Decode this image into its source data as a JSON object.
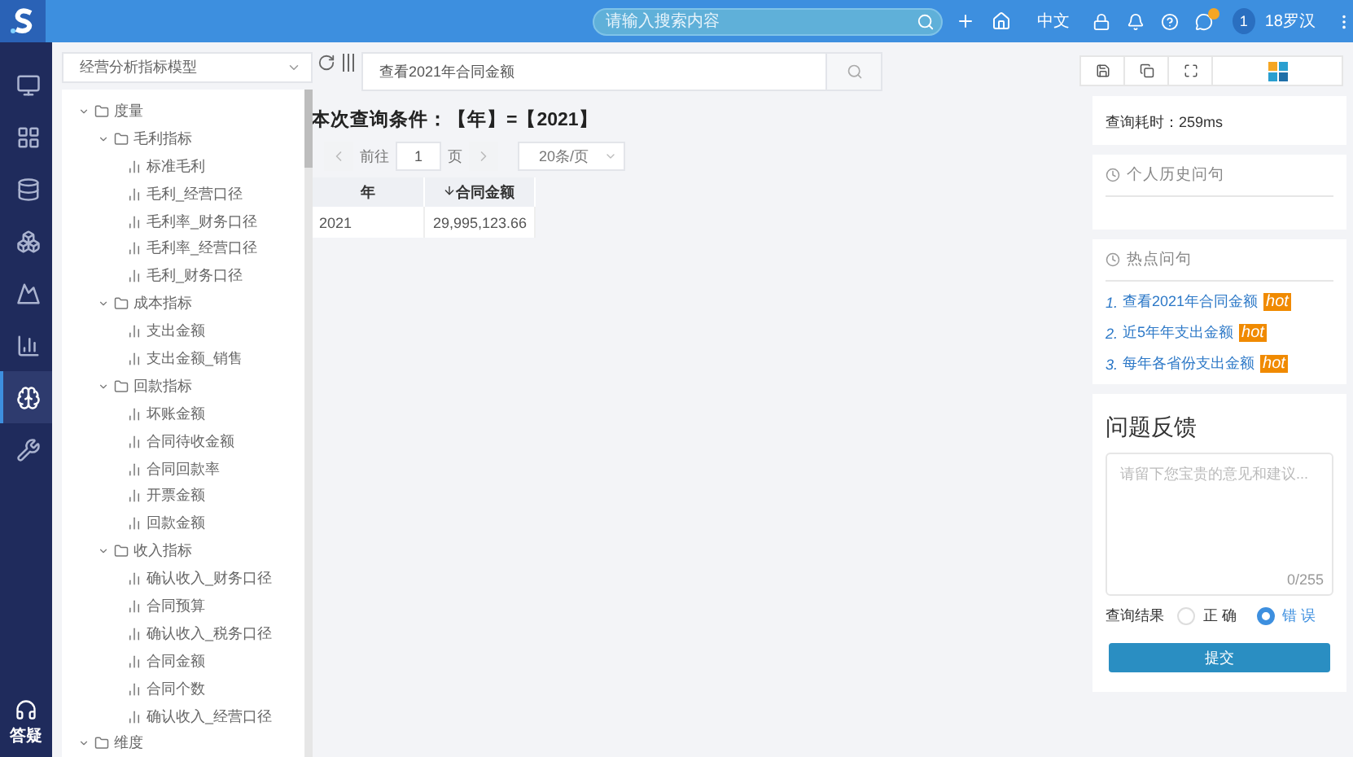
{
  "header": {
    "search": {
      "placeholder": "请输入搜索内容"
    },
    "language": "中文",
    "avatar": "1",
    "user": "18罗汉"
  },
  "nav": {
    "items": [
      {
        "selected": false
      },
      {
        "selected": false
      },
      {
        "selected": false
      },
      {
        "selected": false
      },
      {
        "selected": false
      },
      {
        "selected": false
      },
      {
        "selected": true
      },
      {
        "selected": false
      }
    ],
    "help_label": "答疑"
  },
  "model_select": {
    "value": "经营分析指标模型"
  },
  "tree": [
    {
      "label": "度量",
      "kind": "folder",
      "expanded": true,
      "children": [
        {
          "label": "毛利指标",
          "kind": "folder",
          "expanded": true,
          "children": [
            {
              "label": "标准毛利",
              "kind": "metric"
            },
            {
              "label": "毛利_经营口径",
              "kind": "metric"
            },
            {
              "label": "毛利率_财务口径",
              "kind": "metric"
            },
            {
              "label": "毛利率_经营口径",
              "kind": "metric"
            },
            {
              "label": "毛利_财务口径",
              "kind": "metric"
            }
          ]
        },
        {
          "label": "成本指标",
          "kind": "folder",
          "expanded": true,
          "children": [
            {
              "label": "支出金额",
              "kind": "metric"
            },
            {
              "label": "支出金额_销售",
              "kind": "metric"
            }
          ]
        },
        {
          "label": "回款指标",
          "kind": "folder",
          "expanded": true,
          "children": [
            {
              "label": "坏账金额",
              "kind": "metric"
            },
            {
              "label": "合同待收金额",
              "kind": "metric"
            },
            {
              "label": "合同回款率",
              "kind": "metric"
            },
            {
              "label": "开票金额",
              "kind": "metric"
            },
            {
              "label": "回款金额",
              "kind": "metric"
            }
          ]
        },
        {
          "label": "收入指标",
          "kind": "folder",
          "expanded": true,
          "children": [
            {
              "label": "确认收入_财务口径",
              "kind": "metric"
            },
            {
              "label": "合同预算",
              "kind": "metric"
            },
            {
              "label": "确认收入_税务口径",
              "kind": "metric"
            },
            {
              "label": "合同金额",
              "kind": "metric"
            },
            {
              "label": "合同个数",
              "kind": "metric"
            },
            {
              "label": "确认收入_经营口径",
              "kind": "metric"
            }
          ]
        }
      ]
    },
    {
      "label": "维度",
      "kind": "folder",
      "expanded": true
    }
  ],
  "query": {
    "value": "查看2021年合同金额"
  },
  "condition": "本次查询条件：【年】=【2021】",
  "pagination": {
    "goto": "前往",
    "page": "1",
    "unit": "页",
    "page_size": "20条/页"
  },
  "table": {
    "columns": [
      {
        "label": "年",
        "sorted": false
      },
      {
        "label": "合同金额",
        "sorted": true
      }
    ],
    "rows": [
      [
        "2021",
        "29,995,123.66"
      ]
    ]
  },
  "timing": "查询耗时：259ms",
  "history": {
    "title": "个人历史问句"
  },
  "hot": {
    "title": "热点问句",
    "items": [
      {
        "index": "1.",
        "text": "查看2021年合同金额",
        "badge": "hot"
      },
      {
        "index": "2.",
        "text": "近5年年支出金额",
        "badge": "hot"
      },
      {
        "index": "3.",
        "text": "每年各省份支出金额",
        "badge": "hot"
      }
    ]
  },
  "feedback": {
    "title": "问题反馈",
    "placeholder": "请留下您宝贵的意见和建议...",
    "counter": "0/255",
    "result_label": "查询结果",
    "options": [
      {
        "label": "正 确",
        "selected": false
      },
      {
        "label": "错 误",
        "selected": true
      }
    ],
    "submit": "提交"
  }
}
